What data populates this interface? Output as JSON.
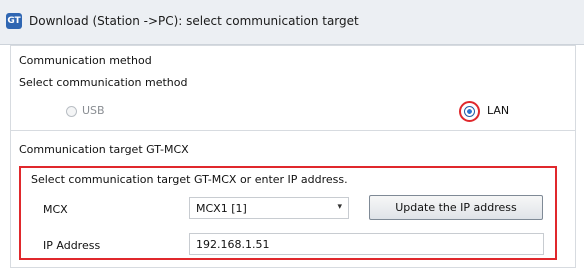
{
  "window": {
    "icon_text": "GT",
    "title": "Download (Station ->PC): select communication target"
  },
  "communication_method": {
    "group_title": "Communication method",
    "prompt": "Select communication method",
    "options": [
      {
        "label": "USB",
        "selected": false,
        "enabled": false
      },
      {
        "label": "LAN",
        "selected": true,
        "enabled": true
      }
    ]
  },
  "communication_target": {
    "group_title": "Communication target GT-MCX",
    "instruction": "Select communication target GT-MCX or enter IP address.",
    "mcx_label": "MCX",
    "mcx_selected": "MCX1 [1]",
    "update_button_label": "Update the IP address",
    "ip_label": "IP Address",
    "ip_value": "192.168.1.51"
  },
  "colors": {
    "highlight": "#e0282c",
    "radio_selected": "#2a74d0"
  }
}
